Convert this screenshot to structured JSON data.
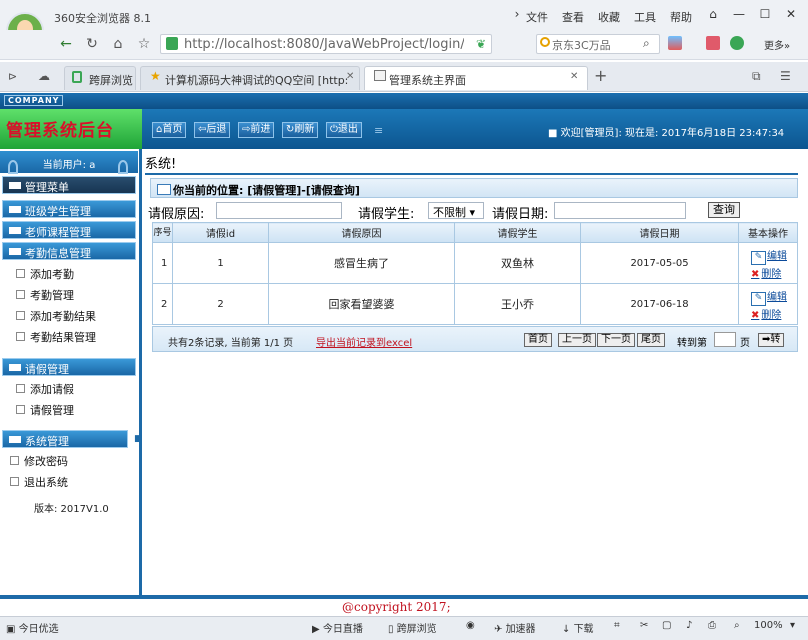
{
  "browser": {
    "name": "360安全浏览器 8.1",
    "menu": [
      "文件",
      "查看",
      "收藏",
      "工具",
      "帮助"
    ],
    "address": "http://localhost:8080/JavaWebProject/login/l",
    "search_placeholder": "京东3C万品",
    "favorites_label": "更多»",
    "tabs": [
      {
        "label": "跨屏浏览",
        "active": false
      },
      {
        "label": "计算机源码大神调试的QQ空间 [http:",
        "active": false
      },
      {
        "label": "管理系统主界面",
        "active": true
      }
    ]
  },
  "header": {
    "company": "COMPANY",
    "title": "管理系统后台",
    "buttons": [
      "首页",
      "后退",
      "前进",
      "刷新",
      "退出"
    ],
    "welcome": "欢迎[管理员]: 现在是: 2017年6月18日 23:47:34"
  },
  "sidebar": {
    "current_user": "当前用户: a",
    "menu_title": "管理菜单",
    "sections": [
      {
        "title": "班级学生管理"
      },
      {
        "title": "老师课程管理"
      },
      {
        "title": "考勤信息管理",
        "items": [
          "添加考勤",
          "考勤管理",
          "添加考勤结果",
          "考勤结果管理"
        ]
      },
      {
        "title": "请假管理",
        "items": [
          "添加请假",
          "请假管理"
        ]
      },
      {
        "title": "系统管理",
        "items": [
          "修改密码",
          "退出系统"
        ]
      }
    ],
    "version": "版本: 2017V1.0"
  },
  "main": {
    "welcome": "系统!",
    "location": "你当前的位置: [请假管理]-[请假查询]",
    "filters": {
      "reason_label": "请假原因:",
      "student_label": "请假学生:",
      "student_value": "不限制",
      "date_label": "请假日期:",
      "query_button": "查询"
    },
    "table": {
      "headers": [
        "序号",
        "请假id",
        "请假原因",
        "请假学生",
        "请假日期",
        "基本操作"
      ],
      "rows": [
        {
          "seq": "1",
          "id": "1",
          "reason": "感冒生病了",
          "student": "双鱼林",
          "date": "2017-05-05"
        },
        {
          "seq": "2",
          "id": "2",
          "reason": "回家看望婆婆",
          "student": "王小乔",
          "date": "2017-06-18"
        }
      ],
      "edit_label": "编辑",
      "delete_label": "删除"
    },
    "pager": {
      "summary": "共有2条记录, 当前第 1/1 页",
      "export": "导出当前记录到excel",
      "first": "首页",
      "prev": "上一页",
      "next": "下一页",
      "last": "尾页",
      "goto_label": "转到第",
      "page_label": "页",
      "go": "转"
    }
  },
  "footer": {
    "copyright": "@copyright 2017;"
  },
  "status": {
    "left": "今日优选",
    "items": [
      "今日直播",
      "跨屏浏览",
      "加速器",
      "下载"
    ],
    "zoom": "100%"
  }
}
